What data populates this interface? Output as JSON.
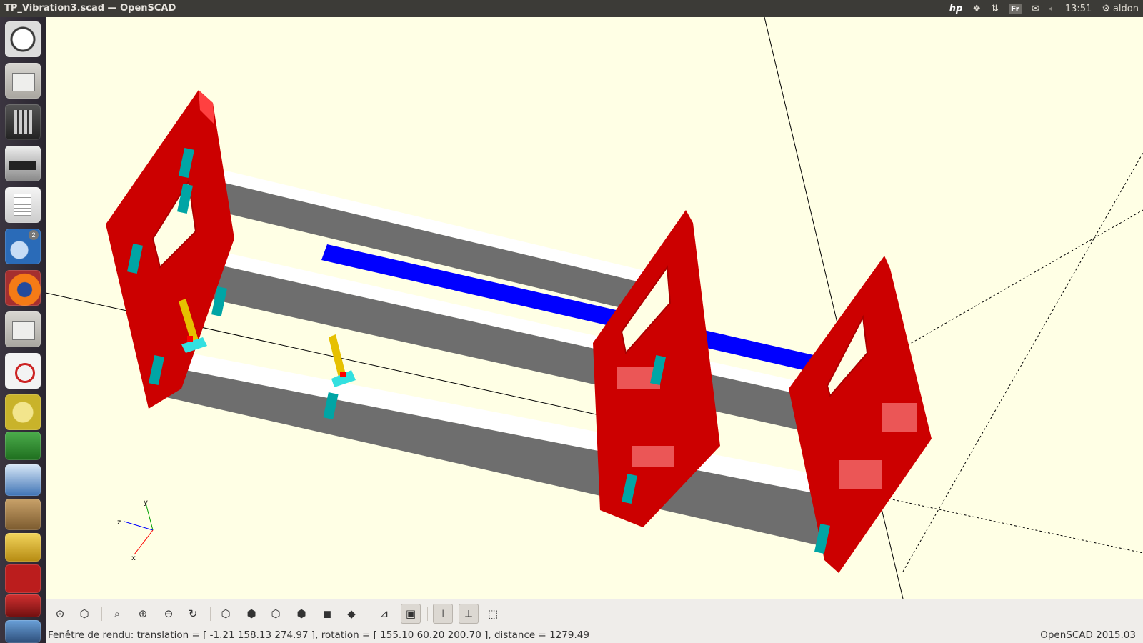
{
  "window": {
    "title": "TP_Vibration3.scad — OpenSCAD"
  },
  "panel": {
    "keyboard_layout": "Fr",
    "clock": "13:51",
    "user": "aldon",
    "icons": [
      "hp-icon",
      "dropbox-icon",
      "network-icon",
      "keyboard-icon",
      "mail-icon",
      "volume-muted-icon",
      "power-gear-icon"
    ]
  },
  "launcher": {
    "items": [
      {
        "name": "ubuntu-dash-icon"
      },
      {
        "name": "files-icon"
      },
      {
        "name": "calculator-icon"
      },
      {
        "name": "scanner-icon"
      },
      {
        "name": "text-editor-icon"
      },
      {
        "name": "thunderbird-icon",
        "badge": "2"
      },
      {
        "name": "firefox-icon"
      },
      {
        "name": "files-2-icon"
      },
      {
        "name": "pdf-viewer-icon"
      },
      {
        "name": "openscad-icon"
      },
      {
        "name": "fg-app-icon"
      },
      {
        "name": "presentation-icon"
      },
      {
        "name": "gimp-icon"
      },
      {
        "name": "game-icon"
      },
      {
        "name": "filezilla-icon"
      },
      {
        "name": "app-red-icon"
      },
      {
        "name": "jr-app-icon"
      }
    ]
  },
  "viewport": {
    "axes_labels": {
      "x": "x",
      "y": "y",
      "z": "z"
    }
  },
  "toolbar": {
    "buttons": [
      {
        "name": "preview-button",
        "glyph": "⊙"
      },
      {
        "name": "render-button",
        "glyph": "⬡"
      },
      {
        "name": "view-all-button",
        "glyph": "⌕"
      },
      {
        "name": "zoom-in-button",
        "glyph": "⊕"
      },
      {
        "name": "zoom-out-button",
        "glyph": "⊖"
      },
      {
        "name": "reset-view-button",
        "glyph": "↻"
      },
      {
        "name": "view-right-button",
        "glyph": "⬡"
      },
      {
        "name": "view-top-button",
        "glyph": "⬢"
      },
      {
        "name": "view-bottom-button",
        "glyph": "⬡"
      },
      {
        "name": "view-left-button",
        "glyph": "⬢"
      },
      {
        "name": "view-front-button",
        "glyph": "◼"
      },
      {
        "name": "view-back-button",
        "glyph": "◆"
      },
      {
        "name": "perspective-button",
        "glyph": "⊿"
      },
      {
        "name": "orthogonal-button",
        "glyph": "▣"
      },
      {
        "name": "show-axes-button",
        "glyph": "⊥"
      },
      {
        "name": "show-scale-markers-button",
        "glyph": "⟂"
      },
      {
        "name": "show-edges-button",
        "glyph": "⬚"
      }
    ]
  },
  "status": {
    "left": "Fenêtre de rendu: translation = [ -1.21 158.13 274.97 ], rotation = [ 155.10 60.20 200.70 ], distance = 1279.49",
    "right": "OpenSCAD 2015.03"
  },
  "colors": {
    "background": "#ffffe5",
    "frame_red": "#cc0000",
    "beam_white": "#ffffff",
    "beam_grey": "#707070",
    "blue_strip": "#0000ff",
    "teal_bracket": "#00a5a5",
    "yellow_link": "#e6c000"
  }
}
